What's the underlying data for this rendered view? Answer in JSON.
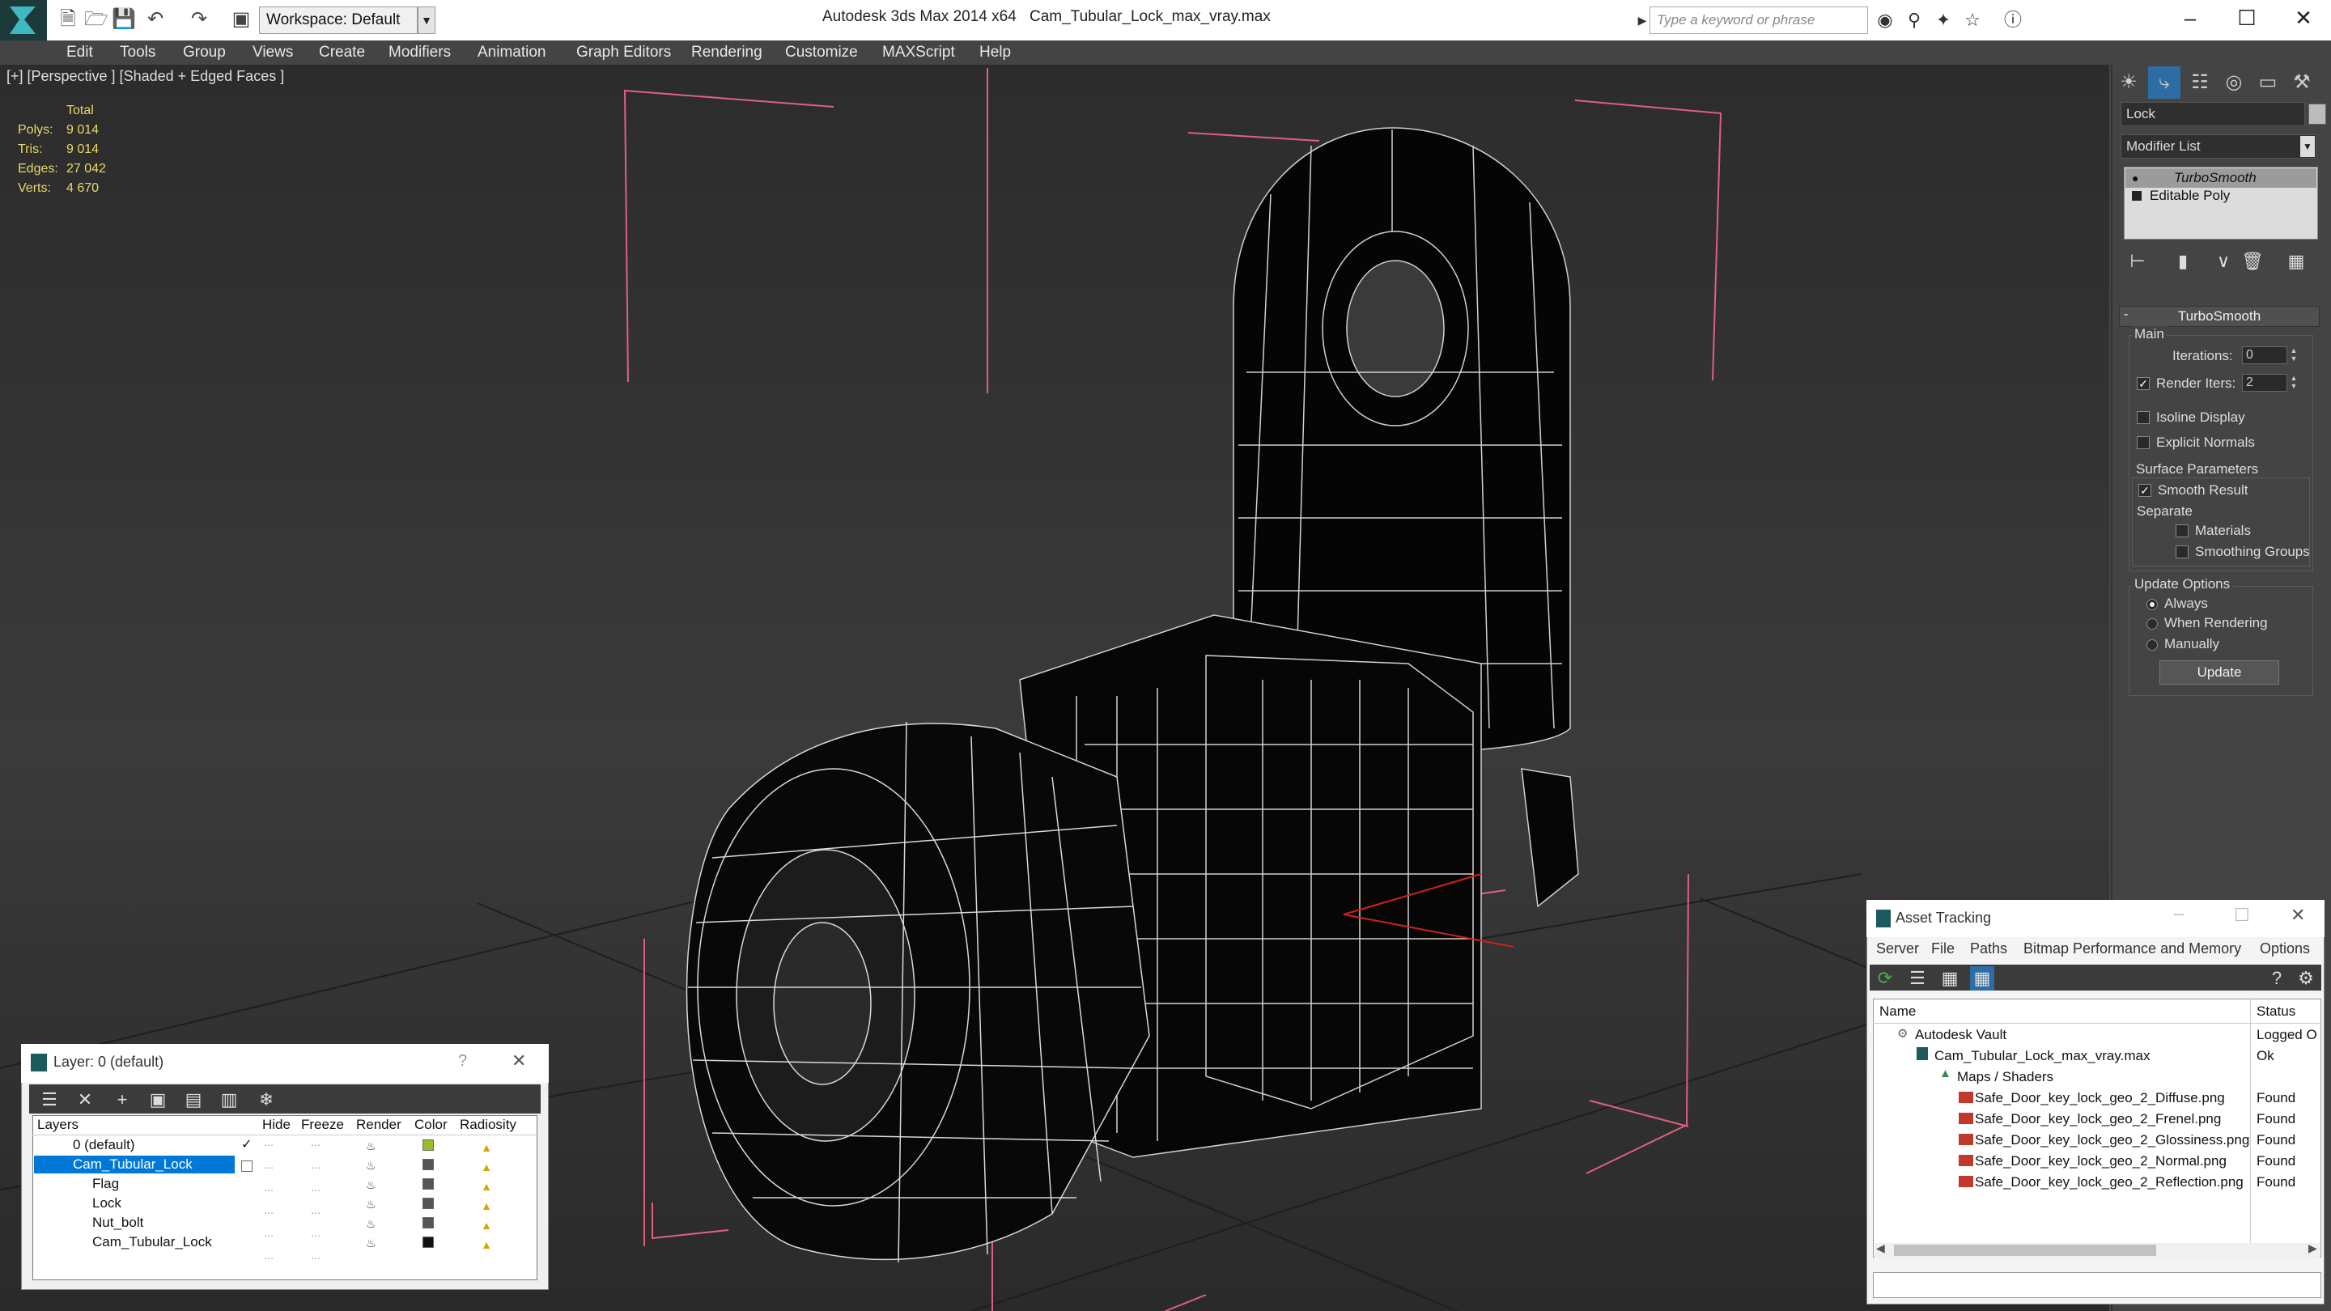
{
  "window": {
    "app_title": "Autodesk 3ds Max 2014 x64",
    "file_title": "Cam_Tubular_Lock_max_vray.max",
    "workspace": "Workspace: Default",
    "search_placeholder": "Type a keyword or phrase"
  },
  "menu": [
    "Edit",
    "Tools",
    "Group",
    "Views",
    "Create",
    "Modifiers",
    "Animation",
    "Graph Editors",
    "Rendering",
    "Customize",
    "MAXScript",
    "Help"
  ],
  "viewport": {
    "label": "[+] [Perspective ] [Shaded + Edged Faces ]",
    "stats_header": "Total",
    "stats": [
      {
        "k": "Polys:",
        "v": "9 014"
      },
      {
        "k": "Tris:",
        "v": "9 014"
      },
      {
        "k": "Edges:",
        "v": "27 042"
      },
      {
        "k": "Verts:",
        "v": "4 670"
      }
    ]
  },
  "command_panel": {
    "object_name": "Lock",
    "modifier_list": "Modifier List",
    "stack": [
      "TurboSmooth",
      "Editable Poly"
    ],
    "rollout_title": "TurboSmooth",
    "main_group": "Main",
    "iterations_label": "Iterations:",
    "iterations_value": "0",
    "render_iters_label": "Render Iters:",
    "render_iters_value": "2",
    "isoline": "Isoline Display",
    "explicit_normals": "Explicit Normals",
    "surface_group": "Surface Parameters",
    "smooth_result": "Smooth Result",
    "separate": "Separate",
    "materials": "Materials",
    "smoothing_groups": "Smoothing Groups",
    "update_group": "Update Options",
    "always": "Always",
    "when_rendering": "When Rendering",
    "manually": "Manually",
    "update_button": "Update"
  },
  "layer_manager": {
    "title": "Layer: 0 (default)",
    "columns": [
      "Layers",
      "Hide",
      "Freeze",
      "Render",
      "Color",
      "Radiosity"
    ],
    "rows": [
      {
        "name": "0 (default)",
        "color": "#9bbd2a"
      },
      {
        "name": "Cam_Tubular_Lock",
        "color": "#555555"
      },
      {
        "name": "Flag",
        "color": "#555555"
      },
      {
        "name": "Lock",
        "color": "#555555"
      },
      {
        "name": "Nut_bolt",
        "color": "#555555"
      },
      {
        "name": "Cam_Tubular_Lock",
        "color": "#111111"
      }
    ]
  },
  "asset_tracking": {
    "title": "Asset Tracking",
    "menu": [
      "Server",
      "File",
      "Paths",
      "Bitmap Performance and Memory",
      "Options"
    ],
    "columns": [
      "Name",
      "Status"
    ],
    "rows": [
      {
        "name": "Autodesk Vault",
        "status": "Logged O"
      },
      {
        "name": "Cam_Tubular_Lock_max_vray.max",
        "status": "Ok"
      },
      {
        "name": "Maps / Shaders",
        "status": ""
      },
      {
        "name": "Safe_Door_key_lock_geo_2_Diffuse.png",
        "status": "Found"
      },
      {
        "name": "Safe_Door_key_lock_geo_2_Frenel.png",
        "status": "Found"
      },
      {
        "name": "Safe_Door_key_lock_geo_2_Glossiness.png",
        "status": "Found"
      },
      {
        "name": "Safe_Door_key_lock_geo_2_Normal.png",
        "status": "Found"
      },
      {
        "name": "Safe_Door_key_lock_geo_2_Reflection.png",
        "status": "Found"
      }
    ]
  },
  "colors": {
    "selection": "#0078d7",
    "stats_text": "#e8d86a",
    "bbox_lines": "#e06080"
  }
}
